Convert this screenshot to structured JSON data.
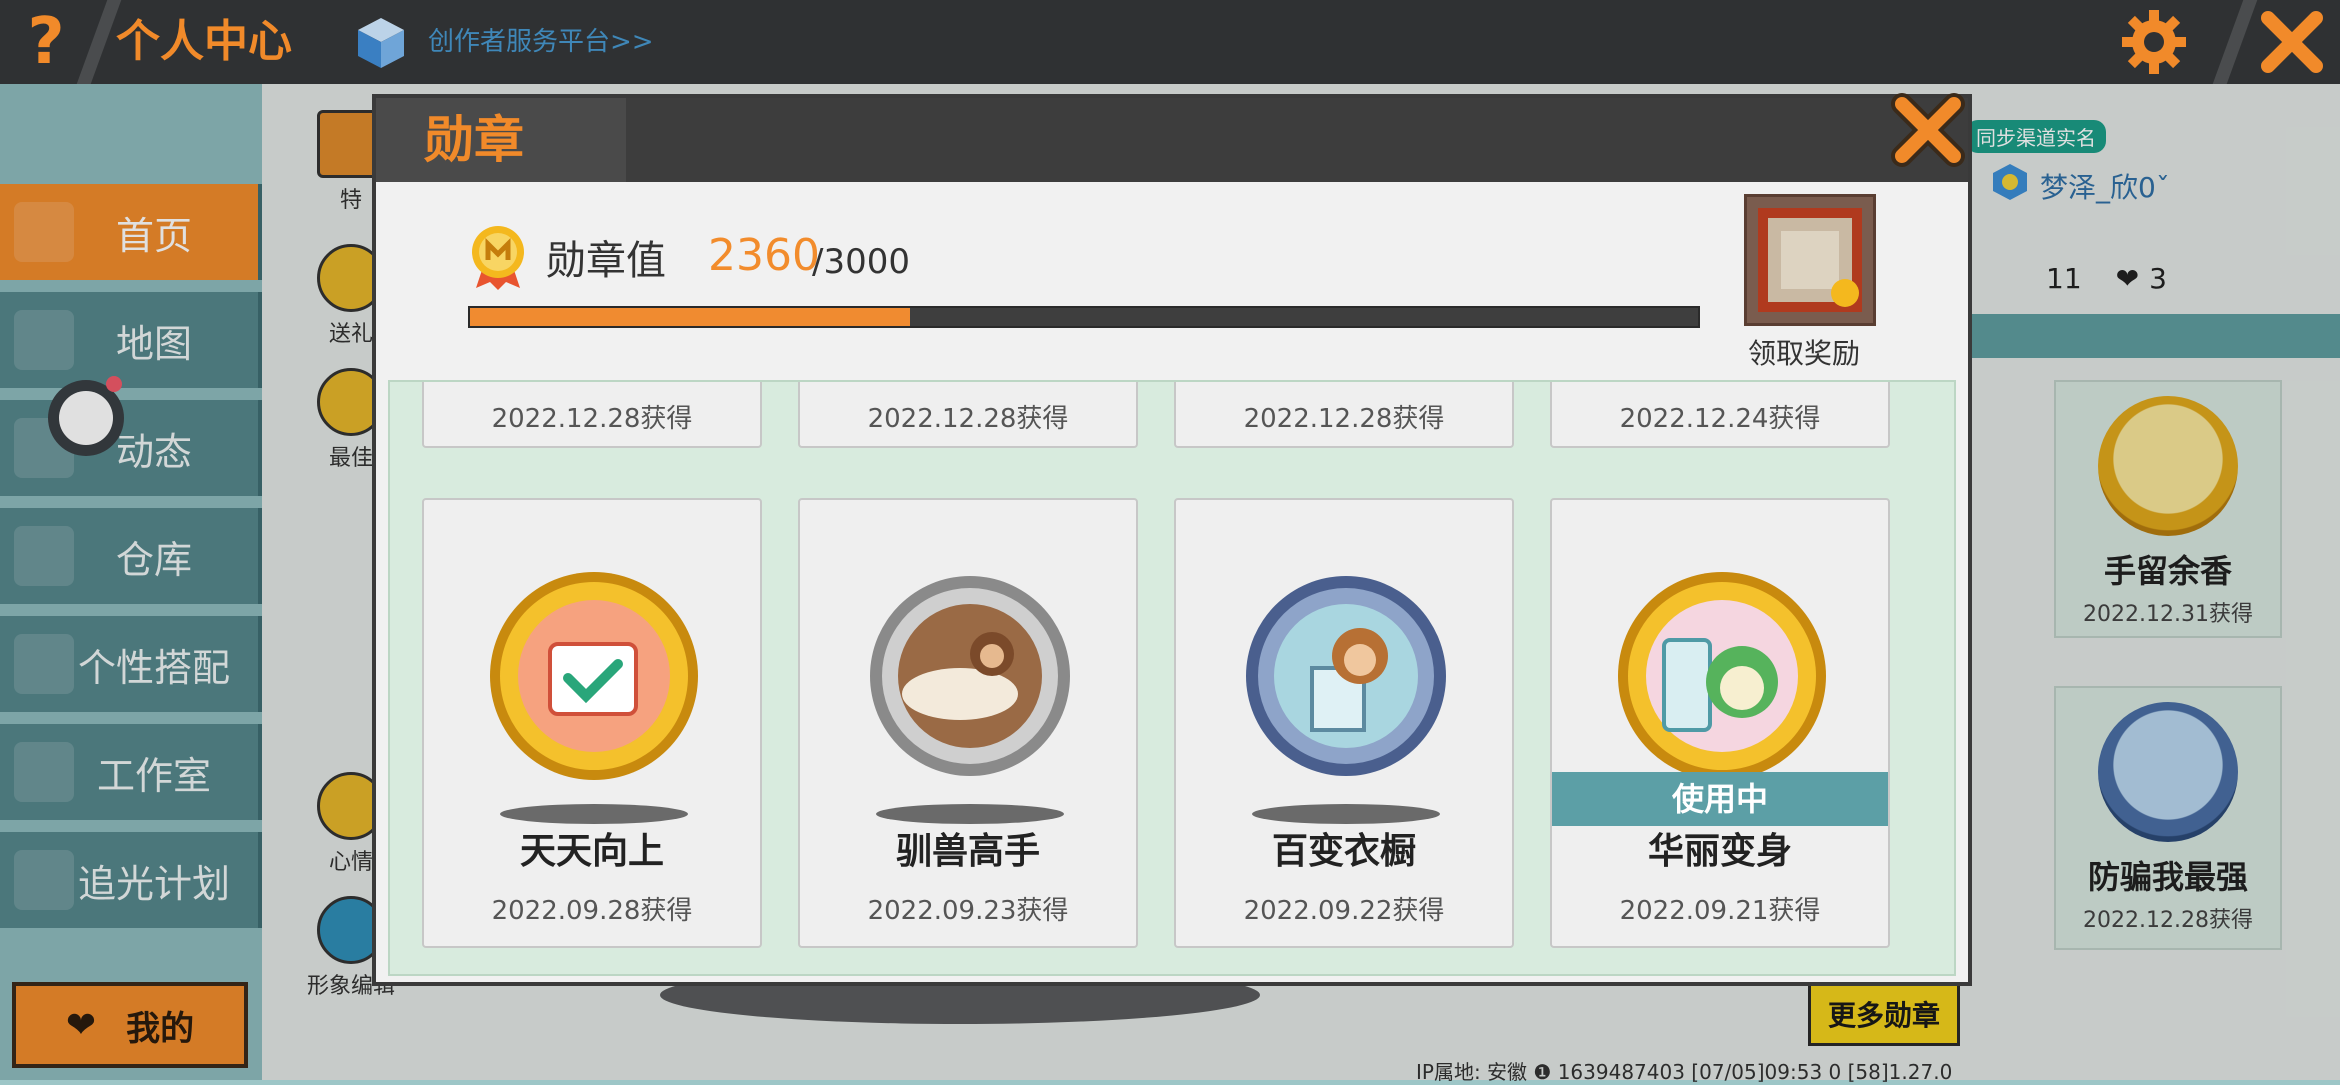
{
  "topbar": {
    "help_icon": "?",
    "title": "个人中心",
    "creator_link": "创作者服务平台>>"
  },
  "sidebar": {
    "items": [
      {
        "label": "首页",
        "active": true
      },
      {
        "label": "地图"
      },
      {
        "label": "动态"
      },
      {
        "label": "仓库"
      },
      {
        "label": "个性搭配"
      },
      {
        "label": "工作室"
      },
      {
        "label": "追光计划"
      }
    ],
    "me_label": "我的"
  },
  "background": {
    "left_items": [
      "特",
      "送礼",
      "最佳",
      "心情",
      "形象编辑"
    ],
    "realname": "同步渠道实名",
    "username": "梦泽_欣0ˇ",
    "stats": {
      "left": "11",
      "likes": "3"
    },
    "right_badges": [
      {
        "name": "手留余香",
        "date": "2022.12.31获得"
      },
      {
        "name": "防骗我最强",
        "date": "2022.12.28获得"
      }
    ],
    "more_badges_label": "更多勋章",
    "ip_line": "IP属地: 安徽 ❶    1639487403    [07/05]09:53 0    [58]1.27.0"
  },
  "modal": {
    "title": "勋章",
    "value_label": "勋章值",
    "value": "2360",
    "value_max": "/3000",
    "progress_fraction": 0.3587,
    "reward_label": "领取奖励",
    "top_row_dates": [
      "2022.12.28获得",
      "2022.12.28获得",
      "2022.12.28获得",
      "2022.12.24获得"
    ],
    "cards": [
      {
        "name": "天天向上",
        "date": "2022.09.28获得",
        "in_use": false,
        "style": "gold"
      },
      {
        "name": "驯兽高手",
        "date": "2022.09.23获得",
        "in_use": false,
        "style": "stone"
      },
      {
        "name": "百变衣橱",
        "date": "2022.09.22获得",
        "in_use": false,
        "style": "steel"
      },
      {
        "name": "华丽变身",
        "date": "2022.09.21获得",
        "in_use": true,
        "style": "gold",
        "in_use_label": "使用中"
      }
    ]
  },
  "colors": {
    "accent": "#f18a2a",
    "teal": "#5c9fa6",
    "dark": "#3d3d3d"
  }
}
